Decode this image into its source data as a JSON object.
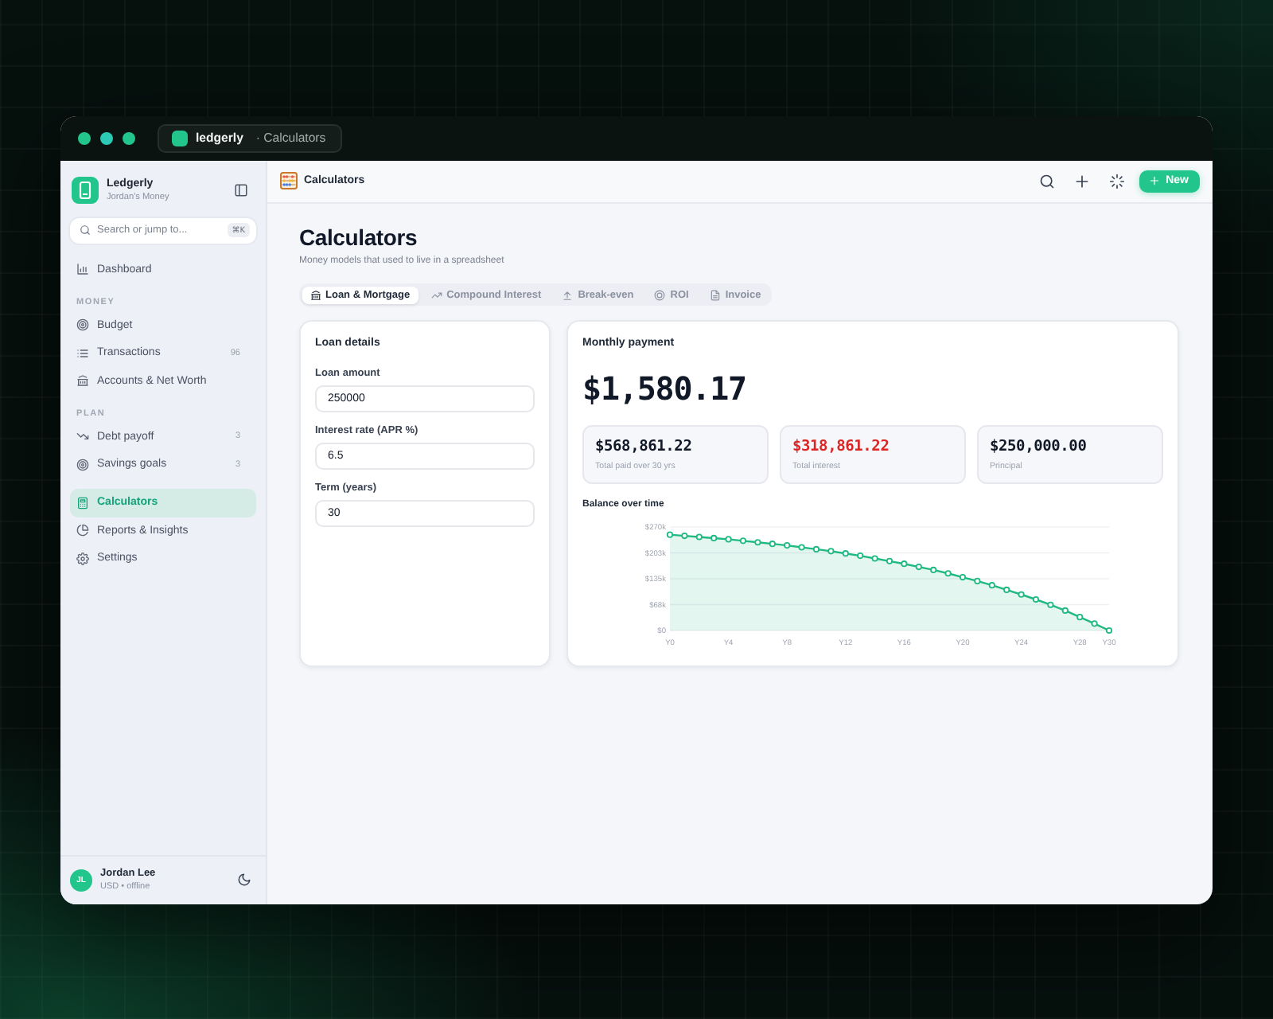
{
  "window": {
    "app_name": "ledgerly",
    "page": "· Calculators"
  },
  "sidebar": {
    "brand": "Ledgerly",
    "workspace": "Jordan's Money",
    "search": {
      "placeholder": "Search or jump to...",
      "shortcut": "⌘K"
    },
    "groups": [
      {
        "items": [
          {
            "label": "Dashboard",
            "selected": false
          }
        ]
      },
      {
        "heading": "MONEY",
        "items": [
          {
            "label": "Budget",
            "selected": false
          },
          {
            "label": "Transactions",
            "count": "96",
            "selected": false
          },
          {
            "label": "Accounts & Net Worth",
            "selected": false
          }
        ]
      },
      {
        "heading": "PLAN",
        "items": [
          {
            "label": "Debt payoff",
            "count": "3",
            "selected": false
          },
          {
            "label": "Savings goals",
            "count": "3",
            "selected": false
          }
        ]
      },
      {
        "items": [
          {
            "label": "Calculators",
            "selected": true
          },
          {
            "label": "Reports & Insights",
            "selected": false
          },
          {
            "label": "Settings",
            "selected": false
          }
        ]
      }
    ],
    "user": {
      "initials": "JL",
      "name": "Jordan Lee",
      "status": "USD • offline"
    }
  },
  "topbar": {
    "title": "Calculators",
    "new_button": "New"
  },
  "page": {
    "title": "Calculators",
    "subtitle": "Money models that used to live in a spreadsheet",
    "tabs": [
      {
        "label": "Loan & Mortgage",
        "selected": true
      },
      {
        "label": "Compound Interest",
        "selected": false
      },
      {
        "label": "Break-even",
        "selected": false
      },
      {
        "label": "ROI",
        "selected": false
      },
      {
        "label": "Invoice",
        "selected": false
      }
    ]
  },
  "loan": {
    "title": "Loan details",
    "fields": [
      {
        "label": "Loan amount",
        "value": "250000"
      },
      {
        "label": "Interest rate (APR %)",
        "value": "6.5"
      },
      {
        "label": "Term (years)",
        "value": "30"
      }
    ]
  },
  "payment": {
    "title": "Monthly payment",
    "amount": "$1,580.17",
    "stats": [
      {
        "value": "$568,861.22",
        "label": "Total paid over 30 yrs",
        "color": "#111827"
      },
      {
        "value": "$318,861.22",
        "label": "Total interest",
        "color": "#dc2626"
      },
      {
        "value": "$250,000.00",
        "label": "Principal",
        "color": "#111827"
      }
    ],
    "chart": {
      "chart_data": {
        "type": "area",
        "title": "Balance over time",
        "categories": [
          "Y0",
          null,
          null,
          null,
          "Y4",
          null,
          null,
          null,
          "Y8",
          null,
          null,
          null,
          "Y12",
          null,
          null,
          null,
          "Y16",
          null,
          null,
          null,
          "Y20",
          null,
          null,
          null,
          "Y24",
          null,
          null,
          null,
          "Y28",
          null,
          "Y30"
        ],
        "ylim": [
          0,
          270000
        ],
        "yticks": [
          {
            "value": 0,
            "label": "$0"
          },
          {
            "value": 67500,
            "label": "$68k"
          },
          {
            "value": 135000,
            "label": "$135k"
          },
          {
            "value": 202500,
            "label": "$203k"
          },
          {
            "value": 270000,
            "label": "$270k"
          }
        ],
        "grid": true,
        "series": [
          {
            "color": "#1fb981",
            "values": [
              250000,
              247000,
              244000,
              241000,
              238000,
              234000,
              230000,
              226000,
              222000,
              217000,
              212000,
              207000,
              201000,
              195000,
              188000,
              181000,
              174000,
              166000,
              158000,
              149000,
              139000,
              129000,
              118000,
              106000,
              94000,
              81000,
              67000,
              52000,
              35000,
              18000,
              0
            ]
          }
        ]
      }
    }
  }
}
